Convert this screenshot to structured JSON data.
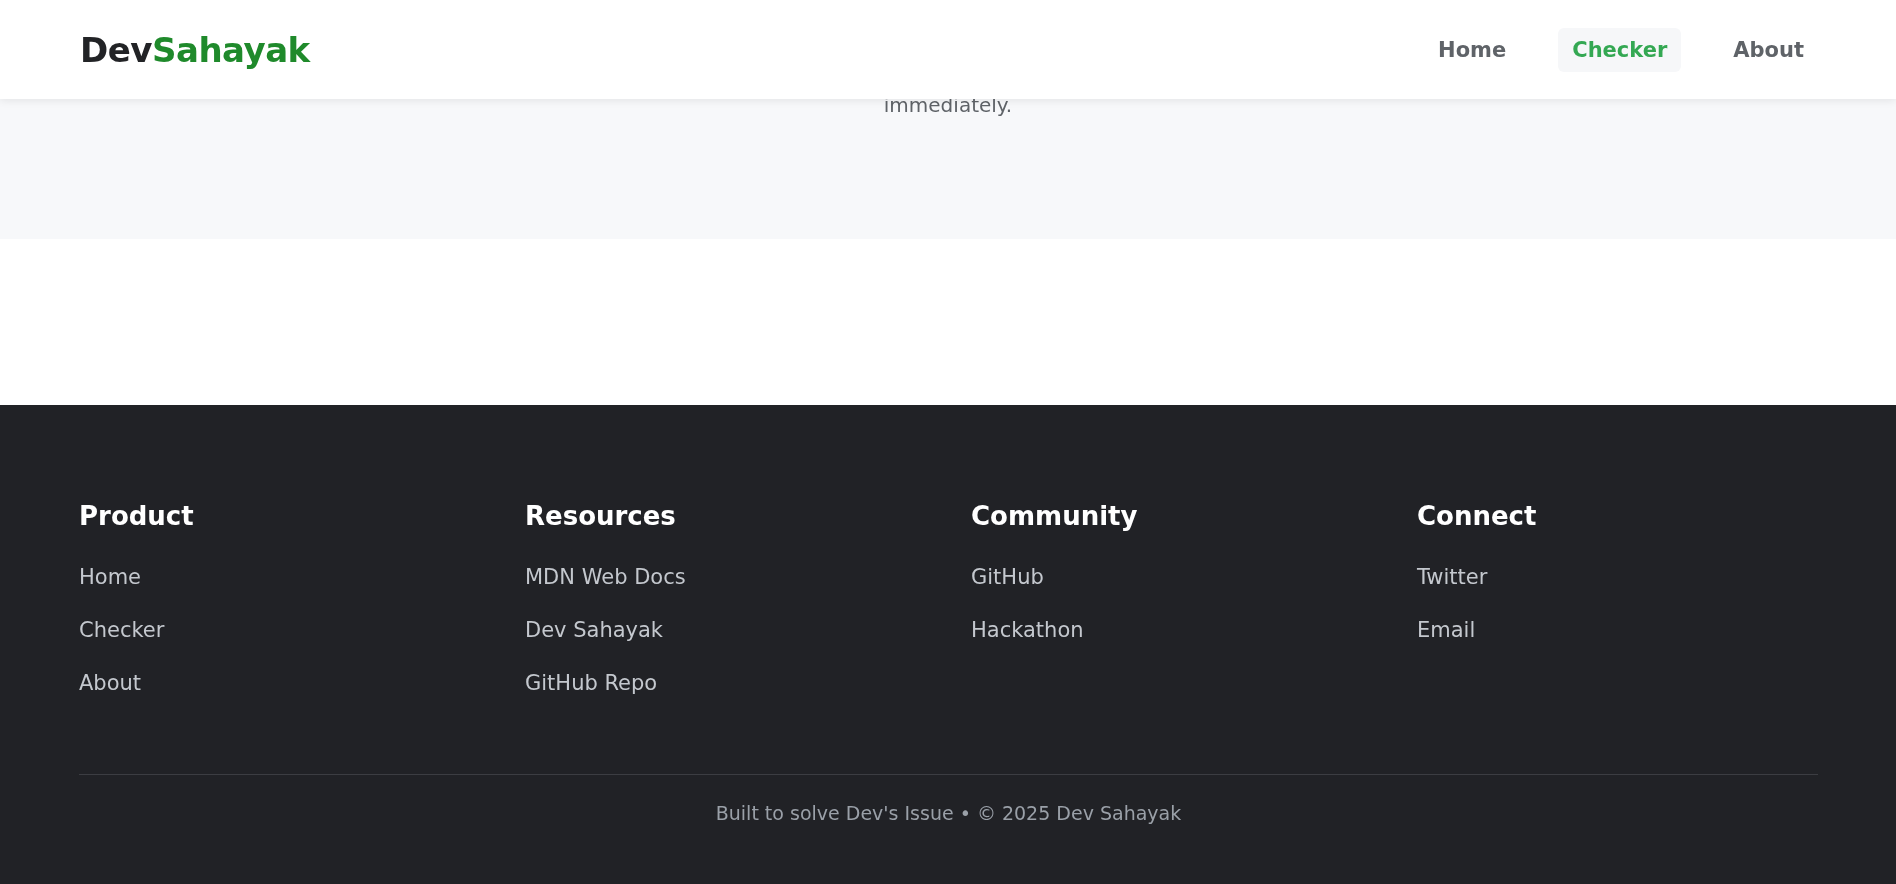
{
  "header": {
    "logo": {
      "part_1": "Dev",
      "part_2": "Sahayak"
    },
    "nav": [
      {
        "label": "Home",
        "selected": false
      },
      {
        "label": "Checker",
        "selected": true
      },
      {
        "label": "About",
        "selected": false
      }
    ]
  },
  "hero": {
    "text": "immediately."
  },
  "footer": {
    "columns": [
      {
        "title": "Product",
        "links": [
          "Home",
          "Checker",
          "About"
        ]
      },
      {
        "title": "Resources",
        "links": [
          "MDN Web Docs",
          "Dev Sahayak",
          "GitHub Repo"
        ]
      },
      {
        "title": "Community",
        "links": [
          "GitHub",
          "Hackathon"
        ]
      },
      {
        "title": "Connect",
        "links": [
          "Twitter",
          "Email"
        ]
      }
    ],
    "copyright": "Built to solve Dev's Issue • © 2025 Dev Sahayak"
  }
}
